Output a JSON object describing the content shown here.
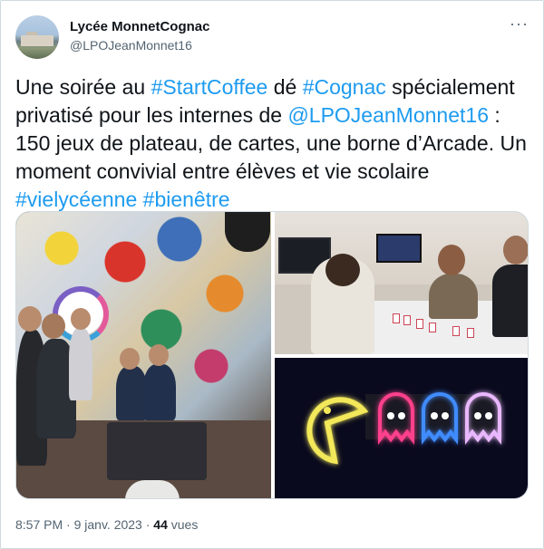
{
  "author": {
    "name": "Lycée MonnetCognac",
    "handle": "@LPOJeanMonnet16"
  },
  "more_icon": "more-horizontal-icon",
  "tweet": {
    "t1": "Une soirée  au ",
    "h1": "#StartCoffee",
    "t2": " dé ",
    "h2": "#Cognac",
    "t3": " spécialement privatisé pour les internes de ",
    "h3": "@LPOJeanMonnet16",
    "t4": " : 150 jeux de plateau, de cartes, une borne d’Arcade. Un moment convivial entre élèves et vie scolaire ",
    "h4": "#vielycéenne",
    "t5": " ",
    "h5": "#bienêtre"
  },
  "meta": {
    "time": "8:57 PM",
    "sep1": " · ",
    "date": "9 janv. 2023",
    "sep2": " · ",
    "views_count": "44",
    "views_label": " vues"
  },
  "colors": {
    "link": "#1d9bf0",
    "text": "#0f1419",
    "secondary": "#536471"
  }
}
